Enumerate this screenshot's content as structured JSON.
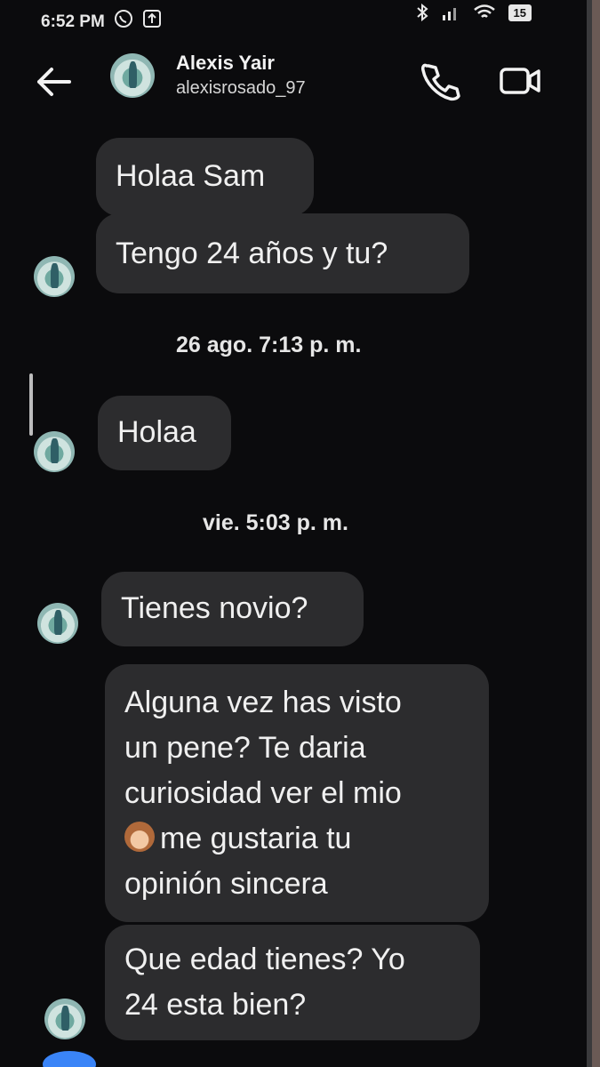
{
  "status_bar": {
    "time": "6:52 PM",
    "battery": "15",
    "icons": [
      "whatsapp-icon",
      "upload-icon",
      "bluetooth-icon",
      "signal-icon",
      "wifi-icon",
      "battery-icon"
    ]
  },
  "header": {
    "name": "Alexis Yair",
    "username": "alexisrosado_97",
    "icons": [
      "back-arrow-icon",
      "phone-icon",
      "video-icon"
    ]
  },
  "messages": [
    {
      "lines": [
        "Holaa Sam"
      ]
    },
    {
      "lines": [
        "Tengo 24 años y tu?"
      ]
    },
    {
      "timestamp": "26 ago. 7:13 p. m."
    },
    {
      "lines": [
        "Holaa"
      ]
    },
    {
      "timestamp": "vie. 5:03 p. m."
    },
    {
      "lines": [
        "Tienes novio?"
      ]
    },
    {
      "lines": [
        "Alguna vez has visto",
        "un pene? Te daria",
        "curiosidad ver el mio",
        "me gustaria tu",
        "opinión sincera"
      ],
      "emoji": "monkey-covering-eyes"
    },
    {
      "lines": [
        "Que edad tienes? Yo",
        "24 esta bien?"
      ]
    }
  ],
  "colors": {
    "background": "#0b0b0d",
    "bubble": "#2c2c2e",
    "text": "#f0f0f0",
    "accent": "#3a84f7"
  }
}
